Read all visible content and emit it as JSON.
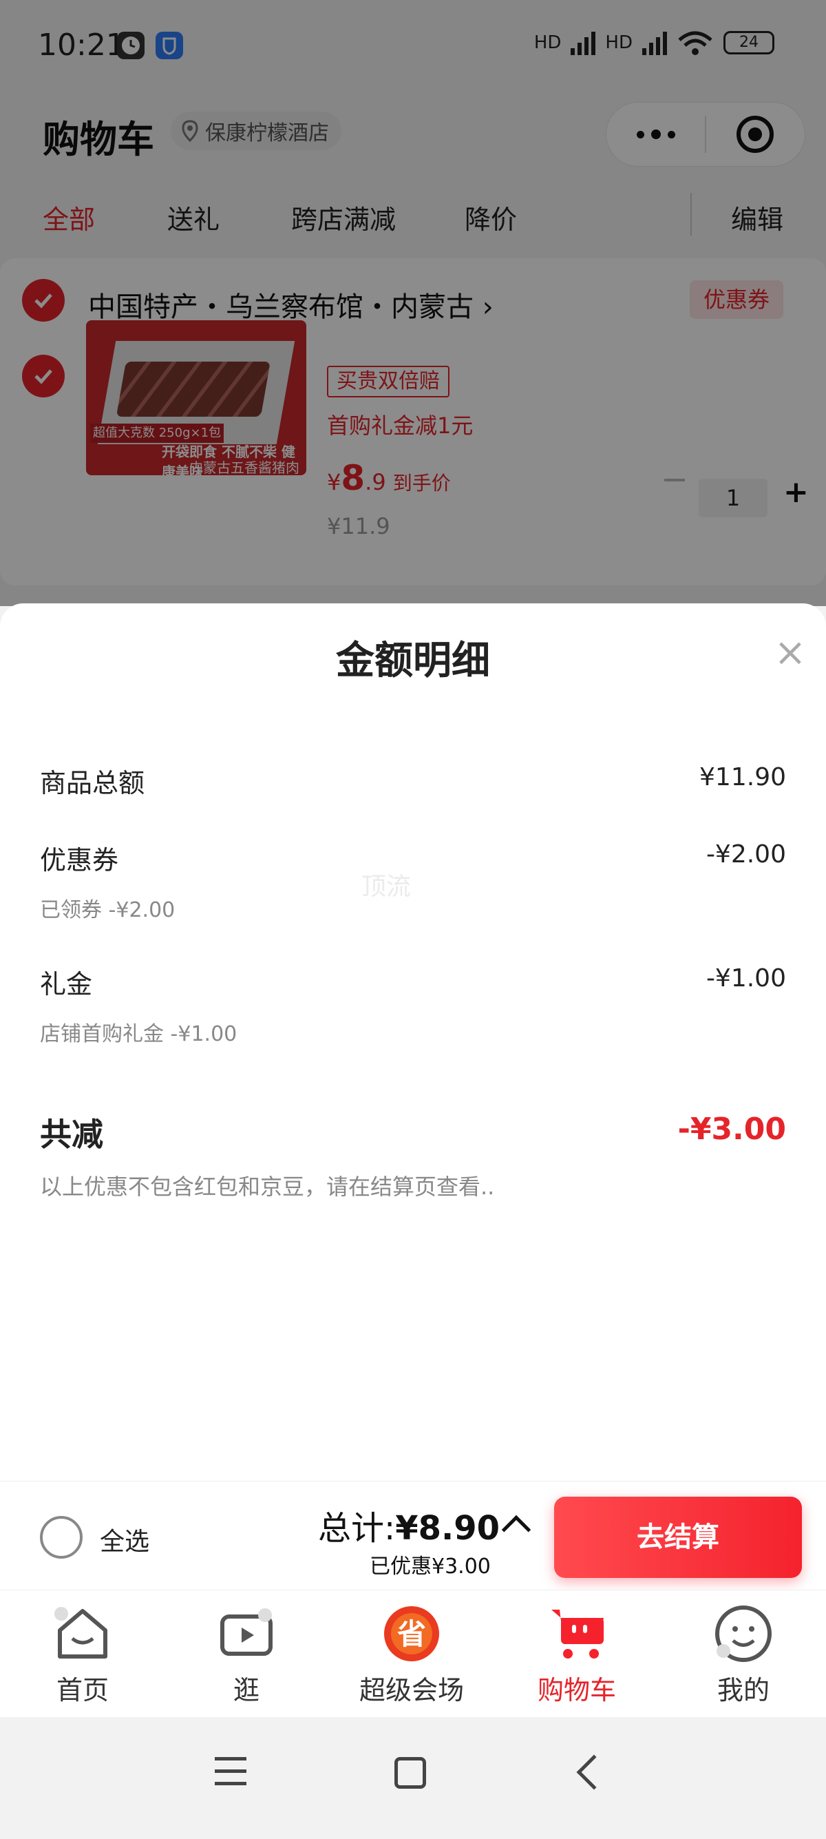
{
  "status_bar": {
    "time": "10:21",
    "battery": "24",
    "signal_label_1": "HD",
    "signal_label_2": "HD"
  },
  "header": {
    "title": "购物车",
    "location": "保康柠檬酒店"
  },
  "filter_tabs": {
    "items": [
      "全部",
      "送礼",
      "跨店满减",
      "降价"
    ],
    "edit": "编辑"
  },
  "store": {
    "name": "中国特产・乌兰察布馆・内蒙古",
    "coupon_tag": "优惠券",
    "product": {
      "image_text_a": "超值大克数 250g×1包",
      "image_text_b": "开袋即食 不腻不柴 健康美味",
      "image_text_c": "内蒙古五香酱猪肉",
      "double_tag": "买贵双倍赔",
      "gift_text": "首购礼金减1元",
      "price_symbol": "¥",
      "price_int": "8",
      "price_dec": ".9",
      "price_label": "到手价",
      "original_price": "¥11.9",
      "quantity": "1"
    }
  },
  "sheet": {
    "title": "金额明细",
    "close_glyph": "×",
    "rows": [
      {
        "label": "商品总额",
        "amount": "¥11.90",
        "sub": ""
      },
      {
        "label": "优惠券",
        "amount": "-¥2.00",
        "sub": "已领券 -¥2.00"
      },
      {
        "label": "礼金",
        "amount": "-¥1.00",
        "sub": "店铺首购礼金 -¥1.00"
      }
    ],
    "watermark": "顶流",
    "total_label": "共减",
    "total_amount": "-¥3.00",
    "note": "以上优惠不包含红包和京豆，请在结算页查看.."
  },
  "checkout": {
    "select_all": "全选",
    "sum_label": "总计:",
    "sum_amount": "¥8.90",
    "saved": "已优惠¥3.00",
    "pay_button": "去结算"
  },
  "bottom_nav": {
    "items": [
      {
        "label": "首页",
        "icon": "home-icon"
      },
      {
        "label": "逛",
        "icon": "video-icon"
      },
      {
        "label": "超级会场",
        "icon": "super-venue-icon"
      },
      {
        "label": "购物车",
        "icon": "cart-icon"
      },
      {
        "label": "我的",
        "icon": "profile-icon"
      }
    ],
    "active": "购物车",
    "venue_glyph": "省"
  },
  "colors": {
    "accent": "#e5242a",
    "overlay": "rgba(0,0,0,0.45)"
  }
}
